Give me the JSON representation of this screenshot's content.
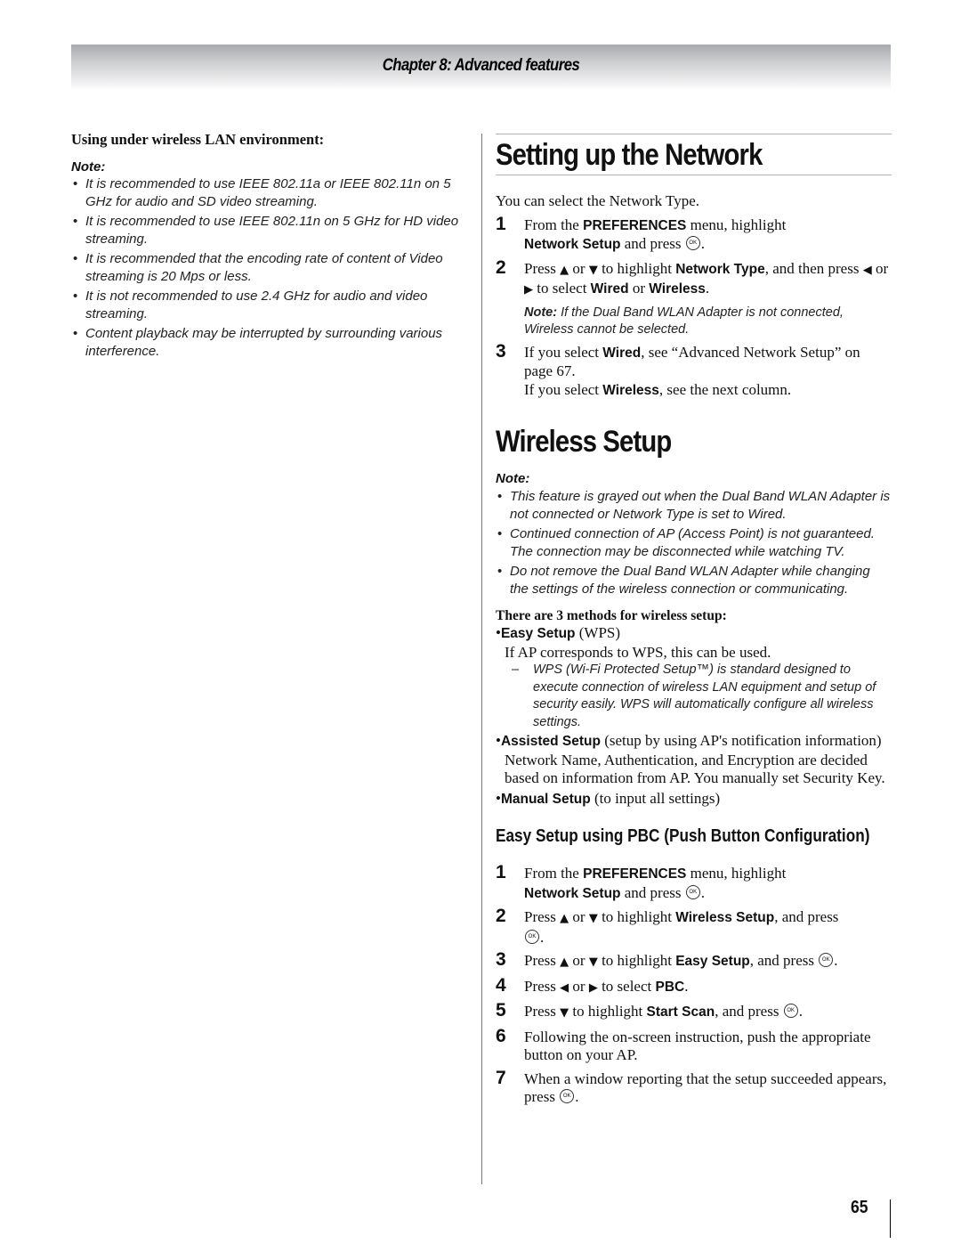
{
  "header": {
    "chapter_title": "Chapter 8: Advanced features"
  },
  "left_column": {
    "subheading": "Using under wireless LAN environment:",
    "note_label": "Note:",
    "notes": [
      "It is recommended to use IEEE 802.11a or IEEE 802.11n on 5 GHz for audio and SD video streaming.",
      "It is recommended to use IEEE 802.11n on 5 GHz for HD video streaming.",
      "It is recommended that the encoding rate of content of Video streaming is 20 Mps or less.",
      "It is not recommended to use 2.4 GHz for audio and video streaming.",
      "Content playback may be interrupted by surrounding various interference."
    ]
  },
  "network_section": {
    "title": "Setting up the Network",
    "intro": "You can select the Network Type.",
    "steps": [
      {
        "num": "1",
        "t1": "From the ",
        "b1": "PREFERENCES",
        "t2": " menu, highlight ",
        "b2": "Network Setup",
        "t3": " and press ",
        "icon": "OK",
        "t4": "."
      },
      {
        "num": "2",
        "t1": "Press ",
        "up": "▲",
        "t2": " or ",
        "down": "▼",
        "t3": " to highlight ",
        "b1": "Network Type",
        "t4": ", and then press ",
        "left": "◀",
        "t5": " or ",
        "right": "▶",
        "t6": " to select ",
        "b2": "Wired",
        "t7": " or ",
        "b3": "Wireless",
        "t8": "."
      },
      {
        "num": "3",
        "t1": "If you select ",
        "b1": "Wired",
        "t2": ", see “Advanced Network Setup” on page 67.",
        "t3": "If you select ",
        "b2": "Wireless",
        "t4": ", see the next column."
      }
    ],
    "inline_note_label": "Note:",
    "inline_note_text": " If the Dual Band WLAN Adapter is not connected, Wireless cannot be selected."
  },
  "wireless_section": {
    "title": "Wireless Setup",
    "note_label": "Note:",
    "notes": [
      "This feature is grayed out when the Dual Band WLAN Adapter is not connected or Network Type is set to Wired.",
      "Continued connection of AP (Access Point) is not guaranteed. The connection may be disconnected while watching TV.",
      "Do not remove the Dual Band WLAN Adapter while changing the settings of the wireless connection or communicating."
    ],
    "methods_heading": "There are 3 methods for wireless setup:",
    "methods": [
      {
        "name": "Easy Setup",
        "suffix": " (WPS)",
        "desc": "If AP corresponds to WPS, this can be used.",
        "subnote": "WPS (Wi-Fi Protected Setup™) is standard designed to execute connection of wireless LAN equipment and setup of security easily. WPS will automatically configure all wireless settings."
      },
      {
        "name": "Assisted Setup",
        "suffix": " (setup by using AP's notification information)",
        "desc": "Network Name, Authentication, and Encryption are decided based on information from AP. You manually set Security Key."
      },
      {
        "name": "Manual Setup",
        "suffix": " (to input all settings)"
      }
    ]
  },
  "pbc_section": {
    "title": "Easy Setup using PBC (Push Button Configuration)",
    "steps": [
      {
        "num": "1",
        "t1": "From the ",
        "b1": "PREFERENCES",
        "t2": " menu, highlight ",
        "b2": "Network Setup",
        "t3": " and press ",
        "t4": "."
      },
      {
        "num": "2",
        "t1": "Press ",
        "t2": " or ",
        "t3": " to highlight ",
        "b1": "Wireless Setup",
        "t4": ", and press ",
        "t5": "."
      },
      {
        "num": "3",
        "t1": "Press ",
        "t2": " or ",
        "t3": " to highlight ",
        "b1": "Easy Setup",
        "t4": ", and press ",
        "t5": "."
      },
      {
        "num": "4",
        "t1": "Press ",
        "t2": " or ",
        "t3": " to select ",
        "b1": "PBC",
        "t4": "."
      },
      {
        "num": "5",
        "t1": "Press ",
        "t2": " to highlight ",
        "b1": "Start Scan",
        "t3": ", and press ",
        "t4": "."
      },
      {
        "num": "6",
        "t1": "Following the on-screen instruction, push the appropriate button on your AP."
      },
      {
        "num": "7",
        "t1": "When a window reporting that the setup succeeded appears, press ",
        "t2": "."
      }
    ]
  },
  "icons": {
    "ok": "OK",
    "up": "▲",
    "down": "▼",
    "left": "◀",
    "right": "▶",
    "bullet": "•",
    "dash": "–"
  },
  "footer": {
    "page_number": "65"
  }
}
